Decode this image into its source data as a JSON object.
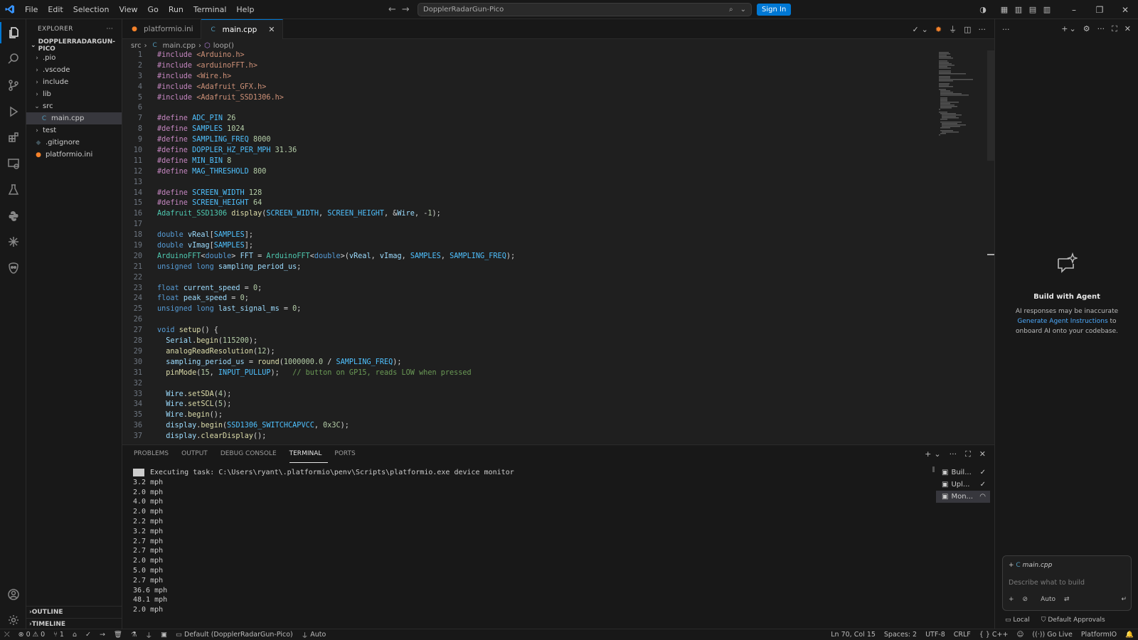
{
  "titlebar": {
    "menus": [
      "File",
      "Edit",
      "Selection",
      "View",
      "Go",
      "Run",
      "Terminal",
      "Help"
    ],
    "search_text": "DopplerRadarGun-Pico",
    "sign_in": "Sign In"
  },
  "explorer": {
    "header": "EXPLORER",
    "root": "DOPPLERRADARGUN-PICO",
    "items": [
      {
        "label": ".pio",
        "kind": "folder",
        "open": false
      },
      {
        "label": ".vscode",
        "kind": "folder",
        "open": false
      },
      {
        "label": "include",
        "kind": "folder",
        "open": false
      },
      {
        "label": "lib",
        "kind": "folder",
        "open": false
      },
      {
        "label": "src",
        "kind": "folder",
        "open": true
      },
      {
        "label": "main.cpp",
        "kind": "cpp-file",
        "selected": true
      },
      {
        "label": "test",
        "kind": "folder",
        "open": false
      },
      {
        "label": ".gitignore",
        "kind": "git-file"
      },
      {
        "label": "platformio.ini",
        "kind": "pio-file"
      }
    ],
    "outline": "OUTLINE",
    "timeline": "TIMELINE"
  },
  "tabs": [
    {
      "label": "platformio.ini",
      "active": false
    },
    {
      "label": "main.cpp",
      "active": true
    }
  ],
  "breadcrumb": {
    "folder": "src",
    "file": "main.cpp",
    "symbol": "loop()"
  },
  "code": {
    "lines": [
      [
        [
          "kw",
          "#include "
        ],
        [
          "st",
          "<Arduino.h>"
        ]
      ],
      [
        [
          "kw",
          "#include "
        ],
        [
          "st",
          "<arduinoFFT.h>"
        ]
      ],
      [
        [
          "kw",
          "#include "
        ],
        [
          "st",
          "<Wire.h>"
        ]
      ],
      [
        [
          "kw",
          "#include "
        ],
        [
          "st",
          "<Adafruit_GFX.h>"
        ]
      ],
      [
        [
          "kw",
          "#include "
        ],
        [
          "st",
          "<Adafruit_SSD1306.h>"
        ]
      ],
      [],
      [
        [
          "kw",
          "#define "
        ],
        [
          "mc",
          "ADC_PIN"
        ],
        [
          "tx",
          " "
        ],
        [
          "nu",
          "26"
        ]
      ],
      [
        [
          "kw",
          "#define "
        ],
        [
          "mc",
          "SAMPLES"
        ],
        [
          "tx",
          " "
        ],
        [
          "nu",
          "1024"
        ]
      ],
      [
        [
          "kw",
          "#define "
        ],
        [
          "mc",
          "SAMPLING_FREQ"
        ],
        [
          "tx",
          " "
        ],
        [
          "nu",
          "8000"
        ]
      ],
      [
        [
          "kw",
          "#define "
        ],
        [
          "mc",
          "DOPPLER_HZ_PER_MPH"
        ],
        [
          "tx",
          " "
        ],
        [
          "nu",
          "31.36"
        ]
      ],
      [
        [
          "kw",
          "#define "
        ],
        [
          "mc",
          "MIN_BIN"
        ],
        [
          "tx",
          " "
        ],
        [
          "nu",
          "8"
        ]
      ],
      [
        [
          "kw",
          "#define "
        ],
        [
          "mc",
          "MAG_THRESHOLD"
        ],
        [
          "tx",
          " "
        ],
        [
          "nu",
          "800"
        ]
      ],
      [],
      [
        [
          "kw",
          "#define "
        ],
        [
          "mc",
          "SCREEN_WIDTH"
        ],
        [
          "tx",
          " "
        ],
        [
          "nu",
          "128"
        ]
      ],
      [
        [
          "kw",
          "#define "
        ],
        [
          "mc",
          "SCREEN_HEIGHT"
        ],
        [
          "tx",
          " "
        ],
        [
          "nu",
          "64"
        ]
      ],
      [
        [
          "cl",
          "Adafruit_SSD1306"
        ],
        [
          "tx",
          " "
        ],
        [
          "fn",
          "display"
        ],
        [
          "tx",
          "("
        ],
        [
          "mc",
          "SCREEN_WIDTH"
        ],
        [
          "tx",
          ", "
        ],
        [
          "mc",
          "SCREEN_HEIGHT"
        ],
        [
          "tx",
          ", &"
        ],
        [
          "va",
          "Wire"
        ],
        [
          "tx",
          ", -"
        ],
        [
          "nu",
          "1"
        ],
        [
          "tx",
          ");"
        ]
      ],
      [],
      [
        [
          "ty",
          "double"
        ],
        [
          "tx",
          " "
        ],
        [
          "va",
          "vReal"
        ],
        [
          "tx",
          "["
        ],
        [
          "mc",
          "SAMPLES"
        ],
        [
          "tx",
          "];"
        ]
      ],
      [
        [
          "ty",
          "double"
        ],
        [
          "tx",
          " "
        ],
        [
          "va",
          "vImag"
        ],
        [
          "tx",
          "["
        ],
        [
          "mc",
          "SAMPLES"
        ],
        [
          "tx",
          "];"
        ]
      ],
      [
        [
          "cl",
          "ArduinoFFT"
        ],
        [
          "tx",
          "<"
        ],
        [
          "ty",
          "double"
        ],
        [
          "tx",
          "> "
        ],
        [
          "va",
          "FFT"
        ],
        [
          "tx",
          " = "
        ],
        [
          "cl",
          "ArduinoFFT"
        ],
        [
          "tx",
          "<"
        ],
        [
          "ty",
          "double"
        ],
        [
          "tx",
          ">("
        ],
        [
          "va",
          "vReal"
        ],
        [
          "tx",
          ", "
        ],
        [
          "va",
          "vImag"
        ],
        [
          "tx",
          ", "
        ],
        [
          "mc",
          "SAMPLES"
        ],
        [
          "tx",
          ", "
        ],
        [
          "mc",
          "SAMPLING_FREQ"
        ],
        [
          "tx",
          ");"
        ]
      ],
      [
        [
          "ty",
          "unsigned long"
        ],
        [
          "tx",
          " "
        ],
        [
          "va",
          "sampling_period_us"
        ],
        [
          "tx",
          ";"
        ]
      ],
      [],
      [
        [
          "ty",
          "float"
        ],
        [
          "tx",
          " "
        ],
        [
          "va",
          "current_speed"
        ],
        [
          "tx",
          " = "
        ],
        [
          "nu",
          "0"
        ],
        [
          "tx",
          ";"
        ]
      ],
      [
        [
          "ty",
          "float"
        ],
        [
          "tx",
          " "
        ],
        [
          "va",
          "peak_speed"
        ],
        [
          "tx",
          " = "
        ],
        [
          "nu",
          "0"
        ],
        [
          "tx",
          ";"
        ]
      ],
      [
        [
          "ty",
          "unsigned long"
        ],
        [
          "tx",
          " "
        ],
        [
          "va",
          "last_signal_ms"
        ],
        [
          "tx",
          " = "
        ],
        [
          "nu",
          "0"
        ],
        [
          "tx",
          ";"
        ]
      ],
      [],
      [
        [
          "ty",
          "void"
        ],
        [
          "tx",
          " "
        ],
        [
          "fn",
          "setup"
        ],
        [
          "tx",
          "() {"
        ]
      ],
      [
        [
          "tx",
          "  "
        ],
        [
          "va",
          "Serial"
        ],
        [
          "tx",
          "."
        ],
        [
          "fn",
          "begin"
        ],
        [
          "tx",
          "("
        ],
        [
          "nu",
          "115200"
        ],
        [
          "tx",
          ");"
        ]
      ],
      [
        [
          "tx",
          "  "
        ],
        [
          "fn",
          "analogReadResolution"
        ],
        [
          "tx",
          "("
        ],
        [
          "nu",
          "12"
        ],
        [
          "tx",
          ");"
        ]
      ],
      [
        [
          "tx",
          "  "
        ],
        [
          "va",
          "sampling_period_us"
        ],
        [
          "tx",
          " = "
        ],
        [
          "fn",
          "round"
        ],
        [
          "tx",
          "("
        ],
        [
          "nu",
          "1000000.0"
        ],
        [
          "tx",
          " / "
        ],
        [
          "mc",
          "SAMPLING_FREQ"
        ],
        [
          "tx",
          ");"
        ]
      ],
      [
        [
          "tx",
          "  "
        ],
        [
          "fn",
          "pinMode"
        ],
        [
          "tx",
          "("
        ],
        [
          "nu",
          "15"
        ],
        [
          "tx",
          ", "
        ],
        [
          "mc",
          "INPUT_PULLUP"
        ],
        [
          "tx",
          ");   "
        ],
        [
          "cm",
          "// button on GP15, reads LOW when pressed"
        ]
      ],
      [],
      [
        [
          "tx",
          "  "
        ],
        [
          "va",
          "Wire"
        ],
        [
          "tx",
          "."
        ],
        [
          "fn",
          "setSDA"
        ],
        [
          "tx",
          "("
        ],
        [
          "nu",
          "4"
        ],
        [
          "tx",
          ");"
        ]
      ],
      [
        [
          "tx",
          "  "
        ],
        [
          "va",
          "Wire"
        ],
        [
          "tx",
          "."
        ],
        [
          "fn",
          "setSCL"
        ],
        [
          "tx",
          "("
        ],
        [
          "nu",
          "5"
        ],
        [
          "tx",
          ");"
        ]
      ],
      [
        [
          "tx",
          "  "
        ],
        [
          "va",
          "Wire"
        ],
        [
          "tx",
          "."
        ],
        [
          "fn",
          "begin"
        ],
        [
          "tx",
          "();"
        ]
      ],
      [
        [
          "tx",
          "  "
        ],
        [
          "va",
          "display"
        ],
        [
          "tx",
          "."
        ],
        [
          "fn",
          "begin"
        ],
        [
          "tx",
          "("
        ],
        [
          "mc",
          "SSD1306_SWITCHCAPVCC"
        ],
        [
          "tx",
          ", "
        ],
        [
          "nu",
          "0x3C"
        ],
        [
          "tx",
          ");"
        ]
      ],
      [
        [
          "tx",
          "  "
        ],
        [
          "va",
          "display"
        ],
        [
          "tx",
          "."
        ],
        [
          "fn",
          "clearDisplay"
        ],
        [
          "tx",
          "();"
        ]
      ]
    ]
  },
  "panel": {
    "tabs": [
      "PROBLEMS",
      "OUTPUT",
      "DEBUG CONSOLE",
      "TERMINAL",
      "PORTS"
    ],
    "active_tab": "TERMINAL",
    "task_line": "Executing task: C:\\Users\\ryant\\.platformio\\penv\\Scripts\\platformio.exe device monitor",
    "output": [
      "3.2 mph",
      "2.0 mph",
      "4.0 mph",
      "2.0 mph",
      "2.2 mph",
      "3.2 mph",
      "2.7 mph",
      "2.7 mph",
      "2.0 mph",
      "5.0 mph",
      "2.7 mph",
      "36.6 mph",
      "48.1 mph",
      "2.0 mph"
    ],
    "terminals": [
      {
        "label": "Buil...",
        "status": "✓"
      },
      {
        "label": "Upl...",
        "status": "✓"
      },
      {
        "label": "Mon...",
        "status": "◠",
        "selected": true
      }
    ]
  },
  "chat": {
    "title": "Build with Agent",
    "desc_pre": "AI responses may be inaccurate",
    "desc_link": "Generate Agent Instructions",
    "desc_post": " to onboard AI onto your codebase.",
    "context_file": "main.cpp",
    "placeholder": "Describe what to build",
    "mode": "Auto",
    "local": "Local",
    "approvals": "Default Approvals"
  },
  "statusbar": {
    "errors": "0",
    "warnings": "0",
    "branch_count": "1",
    "env": "Default (DopplerRadarGun-Pico)",
    "auto": "Auto",
    "position": "Ln 70, Col 15",
    "spaces": "Spaces: 2",
    "encoding": "UTF-8",
    "eol": "CRLF",
    "language": "C++",
    "golive": "Go Live",
    "platformio": "PlatformIO"
  },
  "colors": {
    "accent": "#0078d4",
    "editor_bg": "#1f1f1f",
    "chrome_bg": "#181818"
  }
}
